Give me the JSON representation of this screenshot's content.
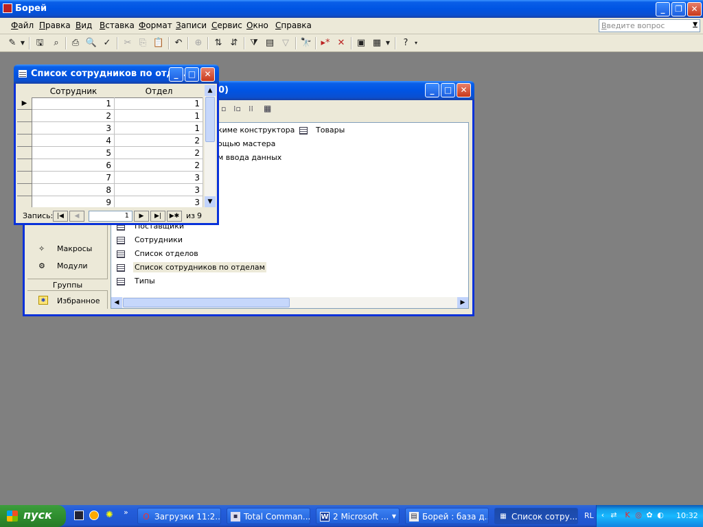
{
  "app": {
    "title": "Борей",
    "menu": [
      "Файл",
      "Правка",
      "Вид",
      "Вставка",
      "Формат",
      "Записи",
      "Сервис",
      "Окно",
      "Справка"
    ],
    "help_placeholder": "Введите вопрос"
  },
  "db_window": {
    "title_fragment": "0)",
    "create_items": [
      "кимe конструктора",
      "ощью мастера",
      "м ввода данных"
    ],
    "top_right_table": "Товары",
    "tables": [
      "Поставщики",
      "Сотрудники",
      "Список отделов",
      "Список сотрудников по отделам",
      "Типы"
    ],
    "sidebar": {
      "objects": [
        "Макросы",
        "Модули"
      ],
      "groups_header": "Группы",
      "groups": [
        "Избранное"
      ]
    }
  },
  "table_window": {
    "title": "Список сотрудников по отде...",
    "columns": [
      "Сотрудник",
      "Отдел"
    ],
    "rows": [
      [
        "1",
        "1"
      ],
      [
        "2",
        "1"
      ],
      [
        "3",
        "1"
      ],
      [
        "4",
        "2"
      ],
      [
        "5",
        "2"
      ],
      [
        "6",
        "2"
      ],
      [
        "7",
        "3"
      ],
      [
        "8",
        "3"
      ],
      [
        "9",
        "3"
      ]
    ],
    "nav": {
      "label": "Запись:",
      "current": "1",
      "of_label": "из",
      "total": "9"
    }
  },
  "taskbar": {
    "start": "пуск",
    "tasks": [
      "Загрузки 11:2...",
      "Total Comman...",
      "2 Microsoft ...",
      "Борей : база д...",
      "Список сотру..."
    ],
    "lang": "RL",
    "clock": "10:32"
  }
}
